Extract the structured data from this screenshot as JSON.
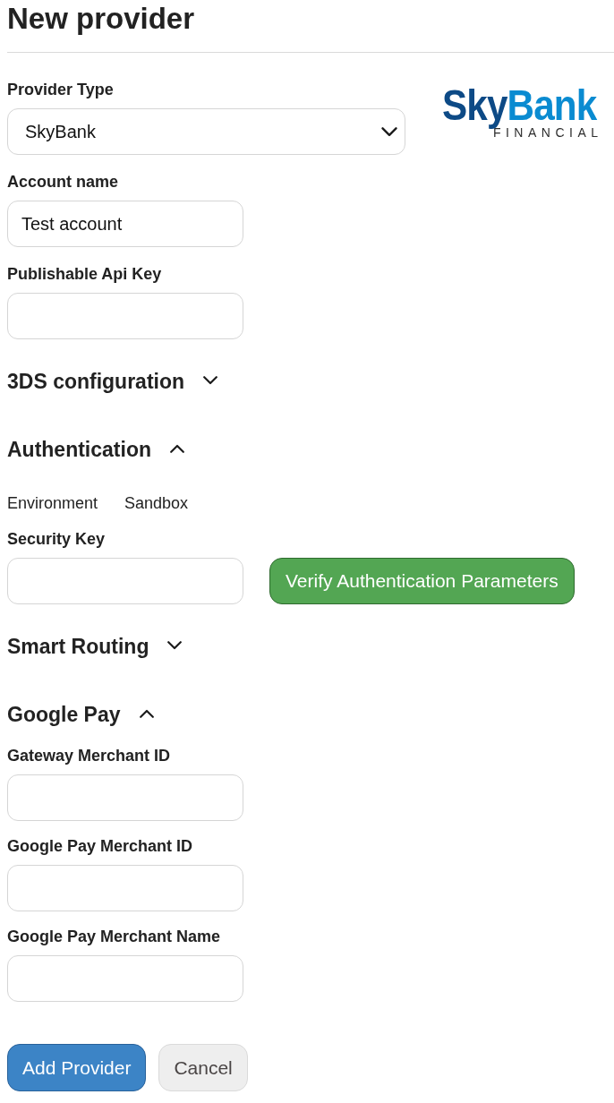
{
  "page": {
    "title": "New provider"
  },
  "logo": {
    "wordmark": [
      "Sky",
      "Bank"
    ],
    "tagline": "FINANCIAL"
  },
  "fields": [
    {
      "kind": "select",
      "label": "Provider Type",
      "value": "SkyBank"
    },
    {
      "kind": "input",
      "label": "Account name",
      "value": "Test account"
    },
    {
      "kind": "input",
      "label": "Publishable Api Key"
    }
  ],
  "sections": [
    {
      "title": "3DS configuration",
      "expanded": false
    },
    {
      "title": "Authentication",
      "expanded": true,
      "items": [
        {
          "kind": "info",
          "label": "Environment",
          "value": "Sandbox"
        },
        {
          "kind": "input_with_button",
          "label": "Security Key",
          "button": "Verify Authentication Parameters"
        }
      ]
    },
    {
      "title": "Smart Routing",
      "expanded": false
    },
    {
      "title": "Google Pay",
      "expanded": true,
      "items": [
        {
          "kind": "input",
          "label": "Gateway Merchant ID"
        },
        {
          "kind": "input",
          "label": "Google Pay Merchant ID"
        },
        {
          "kind": "input",
          "label": "Google Pay Merchant Name"
        }
      ]
    }
  ],
  "buttons": [
    {
      "kind": "primary",
      "label": "Add Provider"
    },
    {
      "kind": "secondary",
      "label": "Cancel"
    }
  ]
}
